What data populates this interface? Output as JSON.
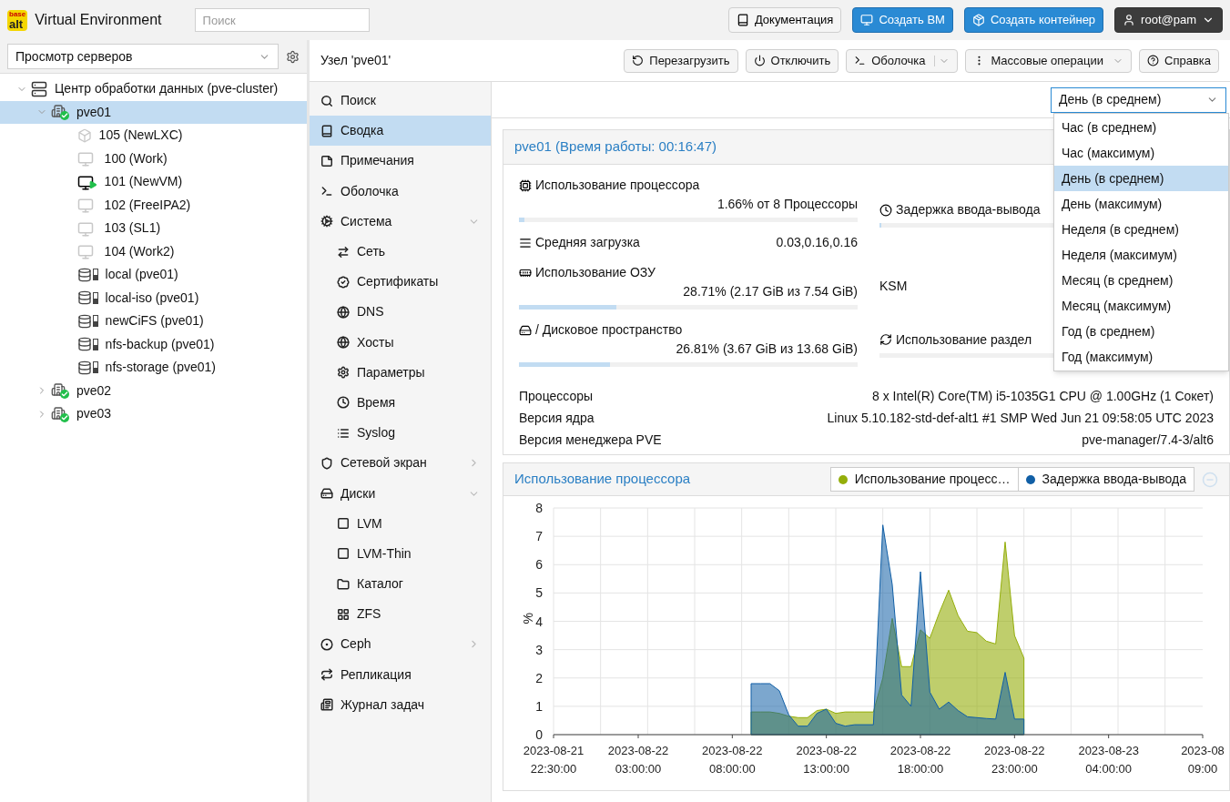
{
  "header": {
    "logo_top": "base",
    "logo_bottom": "alt",
    "title": "Virtual Environment",
    "search": {
      "placeholder": "Поиск"
    },
    "buttons": [
      {
        "label": "Документация",
        "kind": "plain"
      },
      {
        "label": "Создать ВМ",
        "kind": "primary"
      },
      {
        "label": "Создать контейнер",
        "kind": "primary"
      },
      {
        "label": "root@pam",
        "kind": "user"
      }
    ]
  },
  "sidebar": {
    "view_select": "Просмотр серверов",
    "tree": [
      {
        "label": "Центр обработки данных (pve-cluster)",
        "kind": "datacenter",
        "selected": false,
        "expanded": true,
        "children": [
          {
            "label": "pve01",
            "kind": "node",
            "online": true,
            "selected": true,
            "expanded": true,
            "children": [
              {
                "label": "105 (NewLXC)",
                "kind": "lxc",
                "running": false,
                "selected": false
              },
              {
                "label": "100 (Work)",
                "kind": "vm",
                "running": false,
                "selected": false
              },
              {
                "label": "101 (NewVM)",
                "kind": "vm",
                "running": true,
                "selected": false
              },
              {
                "label": "102 (FreeIPA2)",
                "kind": "vm",
                "running": false,
                "selected": false
              },
              {
                "label": "103 (SL1)",
                "kind": "vm",
                "running": false,
                "selected": false
              },
              {
                "label": "104 (Work2)",
                "kind": "vm",
                "running": false,
                "selected": false
              },
              {
                "label": "local (pve01)",
                "kind": "storage",
                "selected": false
              },
              {
                "label": "local-iso (pve01)",
                "kind": "storage",
                "selected": false
              },
              {
                "label": "newCiFS (pve01)",
                "kind": "storage",
                "selected": false
              },
              {
                "label": "nfs-backup (pve01)",
                "kind": "storage",
                "selected": false
              },
              {
                "label": "nfs-storage (pve01)",
                "kind": "storage",
                "selected": false
              }
            ]
          },
          {
            "label": "pve02",
            "kind": "node",
            "online": true,
            "selected": false,
            "expanded": false
          },
          {
            "label": "pve03",
            "kind": "node",
            "online": true,
            "selected": false,
            "expanded": false
          }
        ]
      }
    ]
  },
  "node_toolbar": {
    "title": "Узел 'pve01'",
    "buttons": [
      {
        "label": "Перезагрузить",
        "kind": "plain"
      },
      {
        "label": "Отключить",
        "kind": "plain"
      },
      {
        "label": "Оболочка",
        "kind": "split"
      },
      {
        "label": "Массовые операции",
        "kind": "menu"
      },
      {
        "label": "Справка",
        "kind": "plain"
      }
    ]
  },
  "nav": [
    {
      "label": "Поиск",
      "selected": false
    },
    {
      "label": "Сводка",
      "selected": true
    },
    {
      "label": "Примечания",
      "selected": false
    },
    {
      "label": "Оболочка",
      "selected": false
    },
    {
      "label": "Система",
      "selected": false,
      "expanded": true,
      "children": [
        {
          "label": "Сеть",
          "selected": false
        },
        {
          "label": "Сертификаты",
          "selected": false
        },
        {
          "label": "DNS",
          "selected": false
        },
        {
          "label": "Хосты",
          "selected": false
        },
        {
          "label": "Параметры",
          "selected": false
        },
        {
          "label": "Время",
          "selected": false
        },
        {
          "label": "Syslog",
          "selected": false
        }
      ]
    },
    {
      "label": "Сетевой экран",
      "selected": false,
      "expanded": false
    },
    {
      "label": "Диски",
      "selected": false,
      "expanded": true,
      "children": [
        {
          "label": "LVM",
          "selected": false
        },
        {
          "label": "LVM-Thin",
          "selected": false
        },
        {
          "label": "Каталог",
          "selected": false
        },
        {
          "label": "ZFS",
          "selected": false
        }
      ]
    },
    {
      "label": "Ceph",
      "selected": false,
      "expanded": false
    },
    {
      "label": "Репликация",
      "selected": false
    },
    {
      "label": "Журнал задач",
      "selected": false
    }
  ],
  "timeframe": {
    "value": "День (в среднем)",
    "expanded": true,
    "options": [
      {
        "label": "Час (в среднем)",
        "selected": false
      },
      {
        "label": "Час (максимум)",
        "selected": false
      },
      {
        "label": "День (в среднем)",
        "selected": true
      },
      {
        "label": "День (максимум)",
        "selected": false
      },
      {
        "label": "Неделя (в среднем)",
        "selected": false
      },
      {
        "label": "Неделя (максимум)",
        "selected": false
      },
      {
        "label": "Месяц (в среднем)",
        "selected": false
      },
      {
        "label": "Месяц (максимум)",
        "selected": false
      },
      {
        "label": "Год (в среднем)",
        "selected": false
      },
      {
        "label": "Год (максимум)",
        "selected": false
      }
    ]
  },
  "summary": {
    "title": "pve01 (Время работы: 00:16:47)",
    "stats": [
      {
        "left": [
          {
            "kind": "bar",
            "label": "Использование процессора",
            "reading": "1.66% от 8 Процессоры",
            "level": 0.0166
          },
          {
            "kind": "pair",
            "label": "Средняя загрузка",
            "reading": "0.03,0.16,0.16"
          }
        ],
        "right": {
          "kind": "bar",
          "label": "Задержка ввода-вывода",
          "level": 0.006
        }
      },
      {
        "left": [
          {
            "kind": "bar",
            "label": "Использование ОЗУ",
            "reading": "28.71% (2.17 GiB из 7.54 GiB)",
            "level": 0.2871
          }
        ],
        "right": {
          "kind": "plain",
          "label": "KSM"
        }
      },
      {
        "left": [
          {
            "kind": "bar",
            "label": "/ Дисковое пространство",
            "reading": "26.81% (3.67 GiB из 13.68 GiB)",
            "level": 0.2681
          }
        ],
        "right": {
          "kind": "bar",
          "label": "Использование раздел"
        }
      }
    ],
    "info": [
      {
        "label": "Процессоры",
        "value": "8 x Intel(R) Core(TM) i5-1035G1 CPU @ 1.00GHz (1 Сокет)"
      },
      {
        "label": "Версия ядра",
        "value": "Linux 5.10.182-std-def-alt1 #1 SMP Wed Jun 21 09:58:05 UTC 2023"
      },
      {
        "label": "Версия менеджера PVE",
        "value": "pve-manager/7.4-3/alt6"
      }
    ]
  },
  "cpu_chart": {
    "title": "Использование процессора",
    "chart_data": {
      "type": "area",
      "grid": true,
      "ylabel": "%",
      "ylim": [
        0,
        8
      ],
      "yticks": [
        0,
        1,
        2,
        3,
        4,
        5,
        6,
        7,
        8
      ],
      "categories": [
        "2023-08-21 22:30:00",
        null,
        null,
        null,
        null,
        null,
        null,
        null,
        null,
        "2023-08-22 03:00:00",
        null,
        null,
        null,
        null,
        null,
        null,
        null,
        null,
        null,
        "2023-08-22 08:00:00",
        null,
        null,
        null,
        null,
        null,
        null,
        null,
        null,
        null,
        "2023-08-22 13:00:00",
        null,
        null,
        null,
        null,
        null,
        null,
        null,
        null,
        null,
        "2023-08-22 18:00:00",
        null,
        null,
        null,
        null,
        null,
        null,
        null,
        null,
        null,
        "2023-08-22 23:00:00",
        null,
        null,
        null,
        null,
        null,
        null,
        null,
        null,
        null,
        "2023-08-23 04:00:00",
        null,
        null,
        null,
        null,
        null,
        null,
        null,
        null,
        null,
        "2023-08 09:00"
      ],
      "series": [
        {
          "name": "Использование процесс…",
          "color": "#94ae0a",
          "values": [
            null,
            null,
            null,
            null,
            null,
            null,
            null,
            null,
            null,
            null,
            null,
            null,
            null,
            null,
            null,
            null,
            null,
            null,
            null,
            null,
            null,
            0.8,
            0.8,
            0.8,
            0.75,
            0.65,
            0.6,
            0.6,
            0.85,
            0.9,
            0.75,
            0.8,
            0.8,
            0.8,
            0.8,
            2.0,
            4.1,
            2.4,
            2.4,
            3.7,
            3.4,
            4.3,
            5.1,
            4.2,
            3.65,
            3.6,
            3.3,
            3.2,
            6.8,
            3.5,
            2.7,
            null,
            null,
            null,
            null,
            null,
            null,
            null,
            null,
            null,
            null,
            null,
            null,
            null,
            null,
            null,
            null,
            null,
            null,
            null
          ]
        },
        {
          "name": "Задержка ввода-вывода",
          "color": "#115fa6",
          "values": [
            null,
            null,
            null,
            null,
            null,
            null,
            null,
            null,
            null,
            null,
            null,
            null,
            null,
            null,
            null,
            null,
            null,
            null,
            null,
            null,
            null,
            1.8,
            1.8,
            1.8,
            1.55,
            0.7,
            0.3,
            0.3,
            0.75,
            0.9,
            0.4,
            0.3,
            0.35,
            0.35,
            0.35,
            7.4,
            5.3,
            1.4,
            1.0,
            5.75,
            1.5,
            0.9,
            1.15,
            0.85,
            0.63,
            0.6,
            0.57,
            0.55,
            2.2,
            0.55,
            0.55,
            null,
            null,
            null,
            null,
            null,
            null,
            null,
            null,
            null,
            null,
            null,
            null,
            null,
            null,
            null,
            null,
            null,
            null,
            null
          ]
        }
      ]
    }
  }
}
